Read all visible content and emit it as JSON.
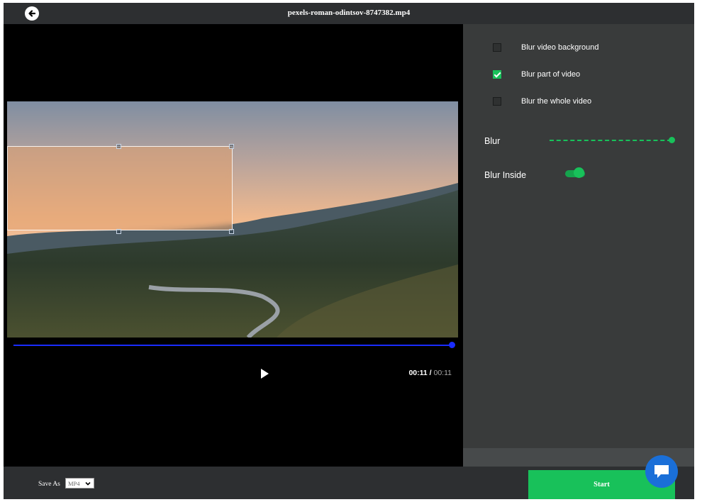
{
  "header": {
    "back_icon": "arrow-left-circle-icon",
    "title": "pexels-roman-odintsov-8747382.mp4"
  },
  "player": {
    "current_time": "00:11",
    "separator": " / ",
    "duration": "00:11",
    "progress": 1.0,
    "play_icon": "play-icon"
  },
  "options": [
    {
      "label": "Blur video background",
      "checked": false
    },
    {
      "label": "Blur part of video",
      "checked": true
    },
    {
      "label": "Blur the whole video",
      "checked": false
    }
  ],
  "blur": {
    "label": "Blur",
    "level": 1.0
  },
  "blur_inside": {
    "label": "Blur Inside",
    "on": true
  },
  "footer": {
    "save_as_label": "Save As",
    "format_value": "MP4",
    "start_label": "Start"
  },
  "chat_icon": "chat-bubble-icon",
  "colors": {
    "accent": "#18c15a",
    "seek": "#1a2cff",
    "chat": "#1a6fd8"
  }
}
